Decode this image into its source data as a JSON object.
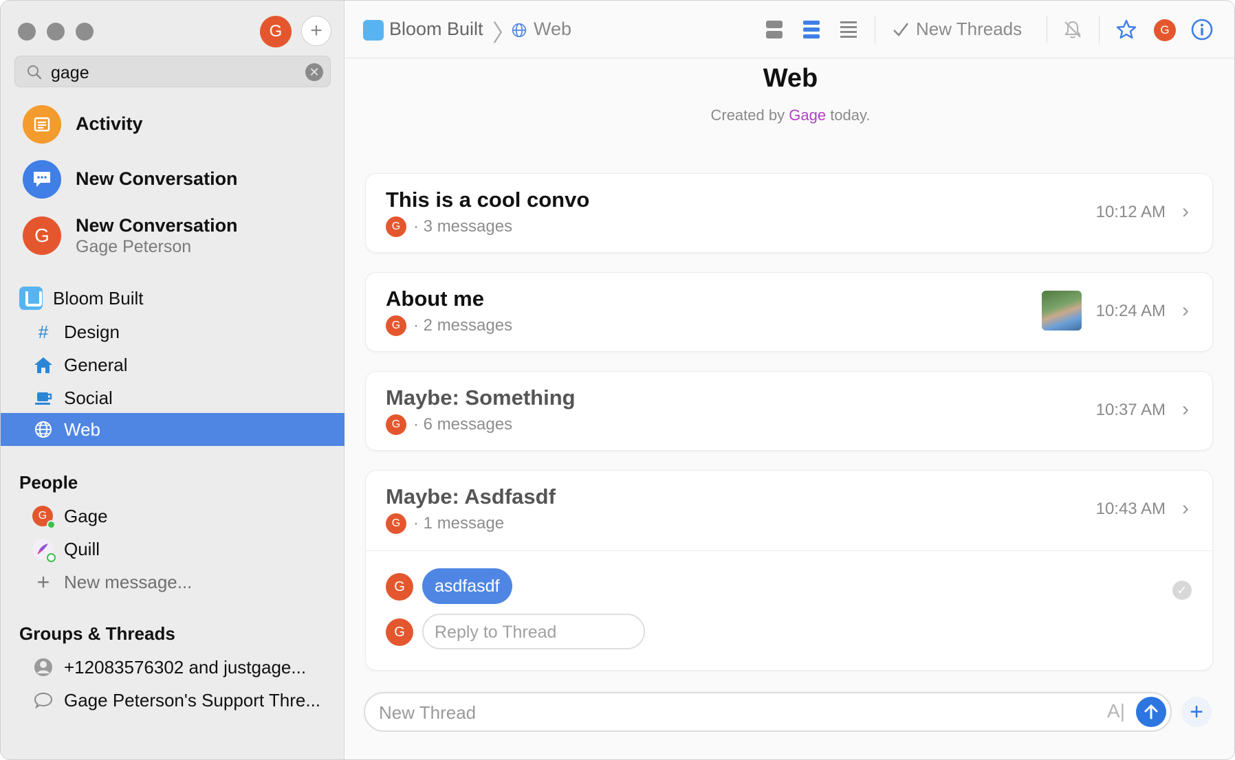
{
  "sidebar": {
    "profile_initial": "G",
    "search": {
      "value": "gage"
    },
    "top_items": [
      {
        "title": "Activity"
      },
      {
        "title": "New Conversation"
      },
      {
        "title": "New Conversation",
        "subtitle": "Gage Peterson",
        "initial": "G"
      }
    ],
    "workspace": "Bloom Built",
    "channels": [
      {
        "label": "Design",
        "icon": "hash-icon"
      },
      {
        "label": "General",
        "icon": "house-icon"
      },
      {
        "label": "Social",
        "icon": "cup-icon"
      },
      {
        "label": "Web",
        "icon": "globe-icon",
        "active": true
      }
    ],
    "people_heading": "People",
    "people": [
      {
        "name": "Gage",
        "initial": "G"
      },
      {
        "name": "Quill"
      }
    ],
    "new_message": "New message...",
    "groups_heading": "Groups & Threads",
    "groups": [
      {
        "label": "+12083576302 and justgage..."
      },
      {
        "label": "Gage Peterson's Support Thre..."
      }
    ]
  },
  "header": {
    "workspace": "Bloom Built",
    "channel": "Web",
    "new_threads": "New Threads",
    "avatar_initial": "G"
  },
  "channel": {
    "title": "Web",
    "created_prefix": "Created by",
    "created_by": "Gage",
    "created_suffix": "today."
  },
  "threads": [
    {
      "title": "This is a cool convo",
      "count": "3 messages",
      "time": "10:12 AM",
      "initial": "G"
    },
    {
      "title": "About me",
      "count": "2 messages",
      "time": "10:24 AM",
      "initial": "G"
    },
    {
      "title": "Maybe: Something",
      "count": "6 messages",
      "time": "10:37 AM",
      "initial": "G"
    },
    {
      "title": "Maybe: Asdfasdf",
      "count": "1 message",
      "time": "10:43 AM",
      "initial": "G",
      "message": "asdfasdf",
      "reply_placeholder": "Reply to Thread"
    }
  ],
  "composer": {
    "placeholder": "New Thread"
  },
  "colors": {
    "accent": "#4f86e3",
    "avatar": "#e4572e",
    "creator": "#b040c8"
  }
}
